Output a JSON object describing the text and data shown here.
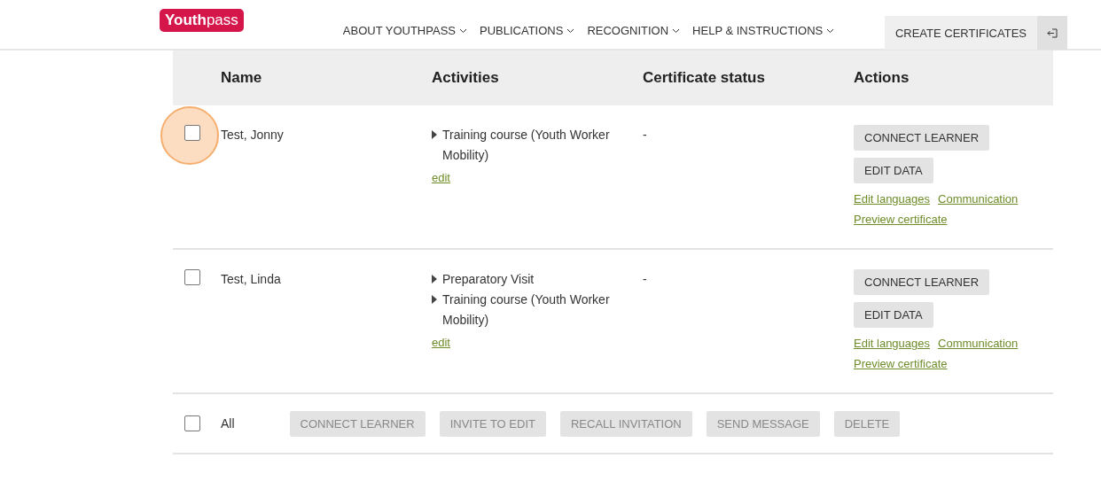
{
  "header": {
    "logo": {
      "bold": "Youth",
      "light": "pass"
    },
    "nav": [
      {
        "label": "ABOUT YOUTHPASS"
      },
      {
        "label": "PUBLICATIONS"
      },
      {
        "label": "RECOGNITION"
      },
      {
        "label": "HELP & INSTRUCTIONS"
      }
    ],
    "cta": "CREATE CERTIFICATES"
  },
  "table": {
    "columns": [
      "Name",
      "Activities",
      "Certificate status",
      "Actions"
    ],
    "rows": [
      {
        "checked": false,
        "highlighted": true,
        "name": "Test, Jonny",
        "activities": [
          "Training course (Youth Worker Mobility)"
        ],
        "edit": "edit",
        "status": "-",
        "buttons": [
          "CONNECT LEARNER",
          "EDIT DATA"
        ],
        "links": [
          "Edit languages",
          "Communication",
          "Preview certificate"
        ]
      },
      {
        "checked": false,
        "highlighted": false,
        "name": "Test, Linda",
        "activities": [
          "Preparatory Visit",
          "Training course (Youth Worker Mobility)"
        ],
        "edit": "edit",
        "status": "-",
        "buttons": [
          "CONNECT LEARNER",
          "EDIT DATA"
        ],
        "links": [
          "Edit languages",
          "Communication",
          "Preview certificate"
        ]
      }
    ]
  },
  "bulk": {
    "checked": false,
    "label": "All",
    "buttons": [
      {
        "label": "CONNECT LEARNER",
        "disabled": true
      },
      {
        "label": "INVITE TO EDIT",
        "disabled": true
      },
      {
        "label": "RECALL INVITATION",
        "disabled": true
      },
      {
        "label": "SEND MESSAGE",
        "disabled": true
      },
      {
        "label": "DELETE",
        "disabled": true
      }
    ]
  }
}
